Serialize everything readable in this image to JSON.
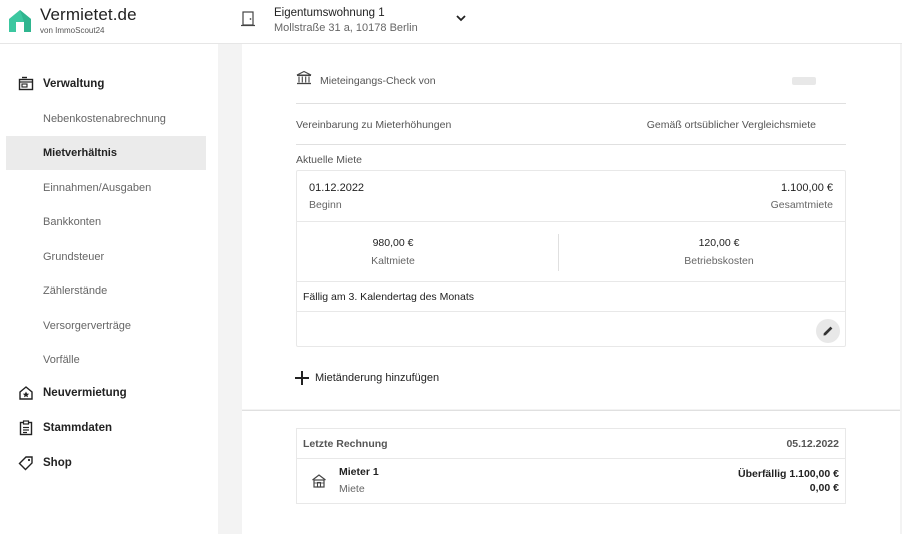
{
  "brand": {
    "name": "Vermietet.de",
    "sub": "von ImmoScout24",
    "logo_icon": "house-logo-icon",
    "accent": "#3cc7a0"
  },
  "property": {
    "title": "Eigentumswohnung 1",
    "address": "Mollstraße 31 a, 10178 Berlin"
  },
  "sidebar": {
    "sections": [
      {
        "label": "Verwaltung",
        "icon": "wallet-icon"
      },
      {
        "label": "Neuvermietung",
        "icon": "house-star-icon"
      },
      {
        "label": "Stammdaten",
        "icon": "clipboard-icon"
      },
      {
        "label": "Shop",
        "icon": "tag-icon"
      }
    ],
    "items": [
      {
        "label": "Nebenkostenabrechnung"
      },
      {
        "label": "Mietverhältnis",
        "active": true
      },
      {
        "label": "Einnahmen/Ausgaben"
      },
      {
        "label": "Bankkonten"
      },
      {
        "label": "Grundsteuer"
      },
      {
        "label": "Zählerstände"
      },
      {
        "label": "Versorgerverträge"
      },
      {
        "label": "Vorfälle"
      }
    ]
  },
  "main": {
    "check_label": "Mieteingangs-Check von",
    "agreement_label": "Vereinbarung zu Mieterhöhungen",
    "agreement_value": "Gemäß ortsüblicher Vergleichsmiete",
    "current_label": "Aktuelle Miete",
    "rent": {
      "date": "01.12.2022",
      "date_label": "Beginn",
      "total": "1.100,00 €",
      "total_label": "Gesamtmiete",
      "cold": "980,00 €",
      "cold_label": "Kaltmiete",
      "costs": "120,00 €",
      "costs_label": "Betriebskosten",
      "due": "Fällig am 3. Kalendertag des Monats"
    },
    "add_label": "Mietänderung hinzufügen"
  },
  "invoice": {
    "header_label": "Letzte Rechnung",
    "header_date": "05.12.2022",
    "tenant": "Mieter 1",
    "type": "Miete",
    "overdue": "Überfällig 1.100,00 €",
    "amount": "0,00 €"
  }
}
